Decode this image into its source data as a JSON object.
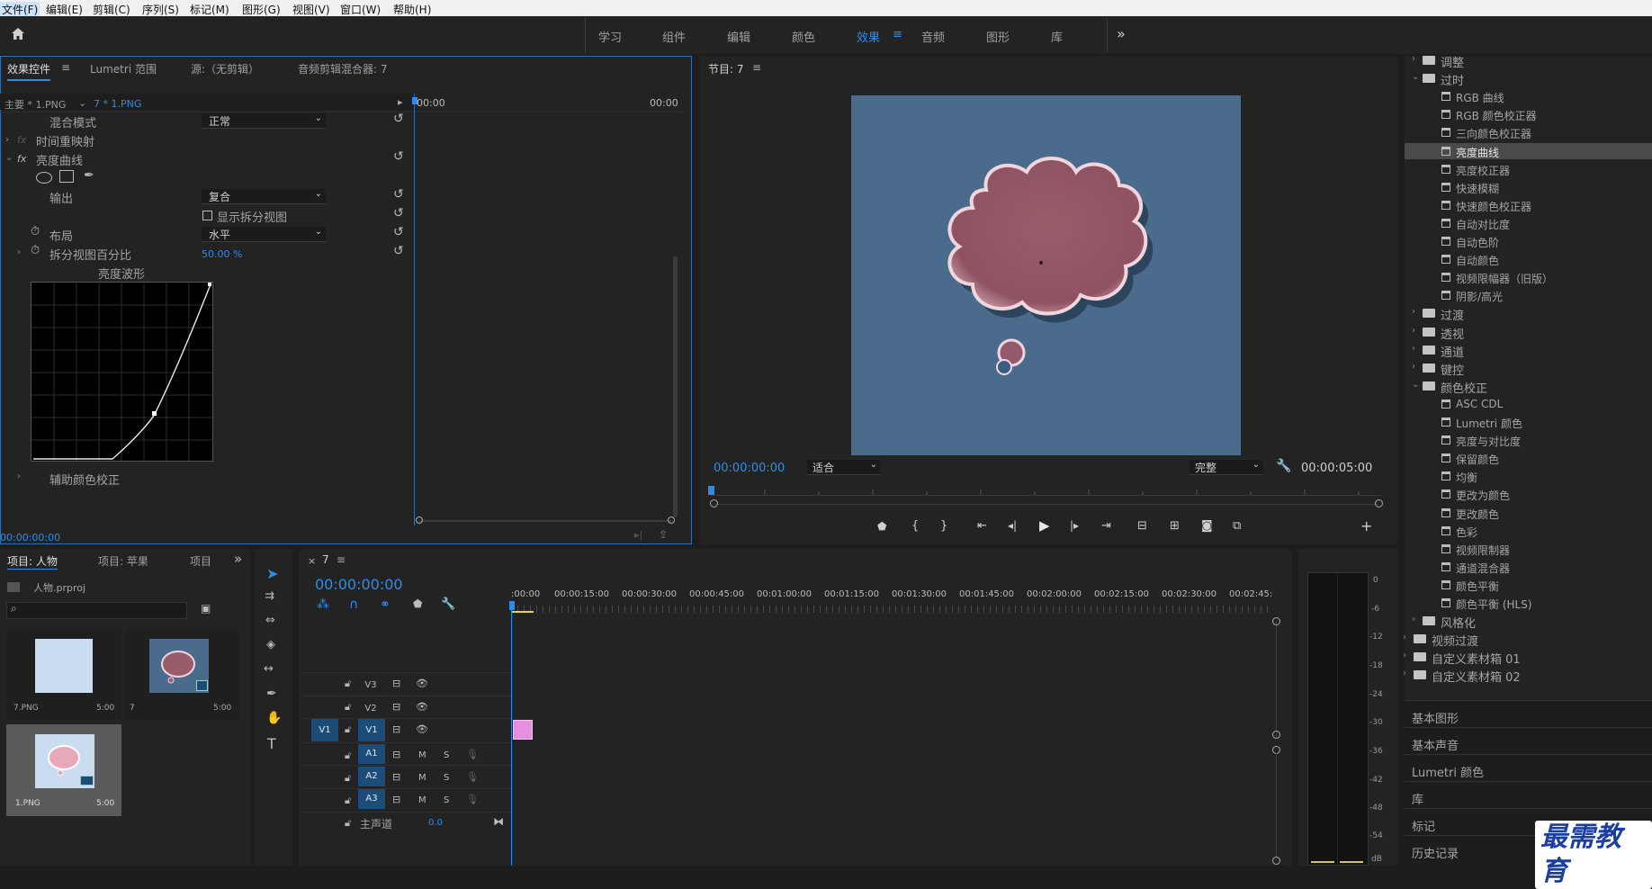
{
  "menu": [
    "文件(F)",
    "编辑(E)",
    "剪辑(C)",
    "序列(S)",
    "标记(M)",
    "图形(G)",
    "视图(V)",
    "窗口(W)",
    "帮助(H)"
  ],
  "workspaces": [
    "学习",
    "组件",
    "编辑",
    "颜色",
    "效果",
    "音频",
    "图形",
    "库"
  ],
  "active_workspace": "效果",
  "effect_controls": {
    "tabs": [
      "效果控件",
      "Lumetri 范围",
      "源:（无剪辑）",
      "音频剪辑混合器: 7"
    ],
    "master": "主要 * 1.PNG",
    "clip": "7 * 1.PNG",
    "timecode_start": "00:00",
    "timecode_end": "00:00",
    "blend_mode_label": "混合模式",
    "blend_mode_value": "正常",
    "time_remap": "时间重映射",
    "luma_curves": "亮度曲线",
    "output_label": "输出",
    "output_value": "复合",
    "show_split": "显示拆分视图",
    "layout_label": "布局",
    "layout_value": "水平",
    "split_pct_label": "拆分视图百分比",
    "split_pct_value": "50.00 %",
    "waveform_label": "亮度波形",
    "aux_color": "辅助颜色校正",
    "bottom_timecode": "00:00:00:00",
    "fx": "fx"
  },
  "program": {
    "title": "节目: 7",
    "timecode": "00:00:00:00",
    "fit": "适合",
    "quality": "完整",
    "duration": "00:00:05:00"
  },
  "effects_tree": [
    {
      "label": "调整",
      "kind": "folder",
      "level": 1,
      "open": false
    },
    {
      "label": "过时",
      "kind": "folder",
      "level": 1,
      "open": true
    },
    {
      "label": "RGB 曲线",
      "kind": "fx",
      "level": 2
    },
    {
      "label": "RGB 颜色校正器",
      "kind": "fx",
      "level": 2
    },
    {
      "label": "三向颜色校正器",
      "kind": "fx",
      "level": 2
    },
    {
      "label": "亮度曲线",
      "kind": "fx",
      "level": 2,
      "selected": true
    },
    {
      "label": "亮度校正器",
      "kind": "fx",
      "level": 2
    },
    {
      "label": "快速模糊",
      "kind": "fx",
      "level": 2
    },
    {
      "label": "快速颜色校正器",
      "kind": "fx",
      "level": 2
    },
    {
      "label": "自动对比度",
      "kind": "fx",
      "level": 2
    },
    {
      "label": "自动色阶",
      "kind": "fx",
      "level": 2
    },
    {
      "label": "自动颜色",
      "kind": "fx",
      "level": 2
    },
    {
      "label": "视频限幅器（旧版）",
      "kind": "fx",
      "level": 2
    },
    {
      "label": "阴影/高光",
      "kind": "fx",
      "level": 2
    },
    {
      "label": "过渡",
      "kind": "folder",
      "level": 1,
      "open": false
    },
    {
      "label": "透视",
      "kind": "folder",
      "level": 1,
      "open": false
    },
    {
      "label": "通道",
      "kind": "folder",
      "level": 1,
      "open": false
    },
    {
      "label": "键控",
      "kind": "folder",
      "level": 1,
      "open": false
    },
    {
      "label": "颜色校正",
      "kind": "folder",
      "level": 1,
      "open": true
    },
    {
      "label": "ASC CDL",
      "kind": "fx",
      "level": 2
    },
    {
      "label": "Lumetri 颜色",
      "kind": "fx",
      "level": 2
    },
    {
      "label": "亮度与对比度",
      "kind": "fx",
      "level": 2
    },
    {
      "label": "保留颜色",
      "kind": "fx",
      "level": 2
    },
    {
      "label": "均衡",
      "kind": "fx",
      "level": 2
    },
    {
      "label": "更改为颜色",
      "kind": "fx",
      "level": 2
    },
    {
      "label": "更改颜色",
      "kind": "fx",
      "level": 2
    },
    {
      "label": "色彩",
      "kind": "fx",
      "level": 2
    },
    {
      "label": "视频限制器",
      "kind": "fx",
      "level": 2
    },
    {
      "label": "通道混合器",
      "kind": "fx",
      "level": 2
    },
    {
      "label": "颜色平衡",
      "kind": "fx",
      "level": 2
    },
    {
      "label": "颜色平衡 (HLS)",
      "kind": "fx",
      "level": 2
    },
    {
      "label": "风格化",
      "kind": "folder",
      "level": 1,
      "open": false
    },
    {
      "label": "视频过渡",
      "kind": "folder",
      "level": 0,
      "open": false
    },
    {
      "label": "自定义素材箱 01",
      "kind": "folder",
      "level": 0,
      "open": false
    },
    {
      "label": "自定义素材箱 02",
      "kind": "folder",
      "level": 0,
      "open": false
    }
  ],
  "right_panels": [
    "基本图形",
    "基本声音",
    "Lumetri 颜色",
    "库",
    "标记",
    "历史记录"
  ],
  "project": {
    "tabs": [
      "项目: 人物",
      "项目: 苹果",
      "项目"
    ],
    "file": "人物.prproj",
    "items": [
      {
        "name": "7.PNG",
        "dur": "5:00"
      },
      {
        "name": "7",
        "dur": "5:00"
      },
      {
        "name": "1.PNG",
        "dur": "5:00"
      }
    ]
  },
  "timeline": {
    "seq_name": "7",
    "timecode": "00:00:00:00",
    "ruler": [
      ":00:00",
      "00:00:15:00",
      "00:00:30:00",
      "00:00:45:00",
      "00:01:00:00",
      "00:01:15:00",
      "00:01:30:00",
      "00:01:45:00",
      "00:02:00:00",
      "00:02:15:00",
      "00:02:30:00",
      "00:02:45:"
    ],
    "video_tracks": [
      "V3",
      "V2",
      "V1"
    ],
    "audio_tracks": [
      "A1",
      "A2",
      "A3"
    ],
    "src_v1": "V1",
    "mute": "M",
    "solo": "S",
    "master": "主声道",
    "master_val": "0.0"
  },
  "meter_labels": [
    "0",
    "-6",
    "-12",
    "-18",
    "-24",
    "-30",
    "-36",
    "-42",
    "-48",
    "-54",
    "dB"
  ],
  "watermark": "最需教育",
  "colors": {
    "accent": "#2d8ceb",
    "frame_bg": "#4a6b8c",
    "cloud": "#9a5c6b",
    "thumb_blue": "#c9dcf0",
    "clip": "#e68ee0"
  }
}
